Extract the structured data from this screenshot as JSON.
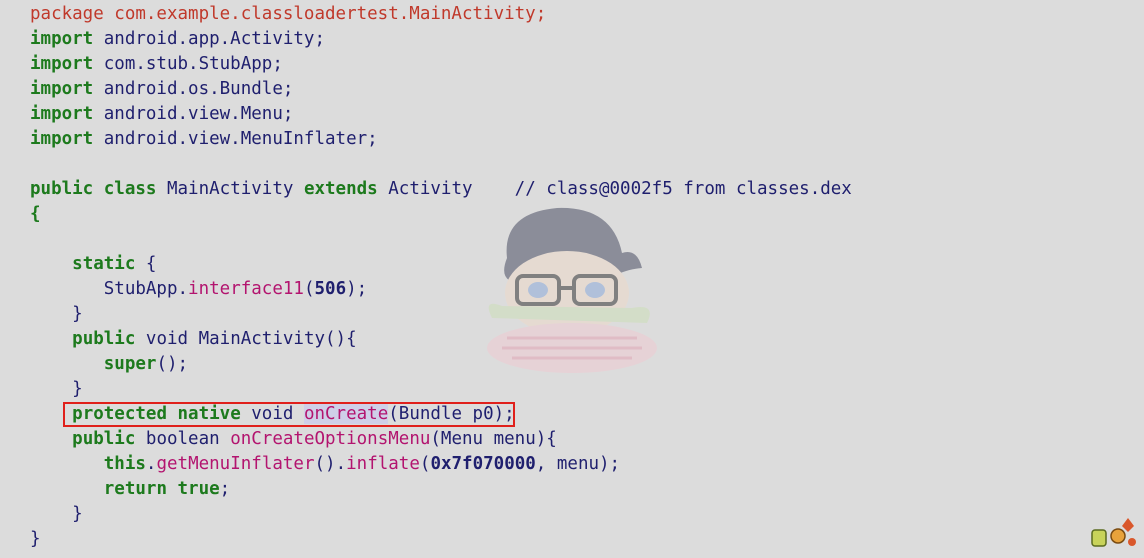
{
  "code_lines": [
    [
      {
        "t": "package com.example.classloadertest.MainActivity;",
        "c": "c-pkg"
      }
    ],
    [
      {
        "t": "import",
        "c": "c-kw"
      },
      {
        "t": " android.app.Activity;",
        "c": "c-id"
      }
    ],
    [
      {
        "t": "import",
        "c": "c-kw"
      },
      {
        "t": " com.stub.StubApp;",
        "c": "c-id"
      }
    ],
    [
      {
        "t": "import",
        "c": "c-kw"
      },
      {
        "t": " android.os.Bundle;",
        "c": "c-id"
      }
    ],
    [
      {
        "t": "import",
        "c": "c-kw"
      },
      {
        "t": " android.view.Menu;",
        "c": "c-id"
      }
    ],
    [
      {
        "t": "import",
        "c": "c-kw"
      },
      {
        "t": " android.view.MenuInflater;",
        "c": "c-id"
      }
    ],
    [],
    [
      {
        "t": "public class",
        "c": "c-kw"
      },
      {
        "t": " MainActivity ",
        "c": "c-id"
      },
      {
        "t": "extends",
        "c": "c-kw"
      },
      {
        "t": " Activity    // class@0002f5 from classes.dex",
        "c": "c-id"
      }
    ],
    [
      {
        "t": "{",
        "c": "c-kw"
      }
    ],
    [],
    [
      {
        "t": "    "
      },
      {
        "t": "static",
        "c": "c-kw"
      },
      {
        "t": " {",
        "c": "c-id"
      }
    ],
    [
      {
        "t": "       StubApp.",
        "c": "c-id"
      },
      {
        "t": "interface11",
        "c": "c-mth"
      },
      {
        "t": "(",
        "c": "c-id"
      },
      {
        "t": "506",
        "c": "c-num"
      },
      {
        "t": ");",
        "c": "c-id"
      }
    ],
    [
      {
        "t": "    }",
        "c": "c-id"
      }
    ],
    [
      {
        "t": "    "
      },
      {
        "t": "public",
        "c": "c-kw"
      },
      {
        "t": " void MainActivity(){",
        "c": "c-id"
      }
    ],
    [
      {
        "t": "       "
      },
      {
        "t": "super",
        "c": "c-kw"
      },
      {
        "t": "();",
        "c": "c-id"
      }
    ],
    [
      {
        "t": "    }",
        "c": "c-id"
      }
    ],
    [
      {
        "t": "    "
      },
      {
        "t": "protected native",
        "c": "c-kw"
      },
      {
        "t": " void ",
        "c": "c-id"
      },
      {
        "t": "onCreate",
        "c": "c-mth hl-word"
      },
      {
        "t": "(Bundle p0);",
        "c": "c-id"
      }
    ],
    [
      {
        "t": "    "
      },
      {
        "t": "public",
        "c": "c-kw"
      },
      {
        "t": " boolean ",
        "c": "c-id"
      },
      {
        "t": "onCreateOptionsMenu",
        "c": "c-mth"
      },
      {
        "t": "(Menu menu){",
        "c": "c-id"
      }
    ],
    [
      {
        "t": "       "
      },
      {
        "t": "this",
        "c": "c-kw"
      },
      {
        "t": ".",
        "c": "c-id"
      },
      {
        "t": "getMenuInflater",
        "c": "c-mth"
      },
      {
        "t": "().",
        "c": "c-id"
      },
      {
        "t": "inflate",
        "c": "c-mth"
      },
      {
        "t": "(",
        "c": "c-id"
      },
      {
        "t": "0x7f070000",
        "c": "c-num"
      },
      {
        "t": ", menu);",
        "c": "c-id"
      }
    ],
    [
      {
        "t": "       "
      },
      {
        "t": "return true",
        "c": "c-kw"
      },
      {
        "t": ";",
        "c": "c-id"
      }
    ],
    [
      {
        "t": "    }",
        "c": "c-id"
      }
    ],
    [
      {
        "t": "}",
        "c": "c-id"
      }
    ]
  ],
  "highlight": {
    "line_index": 16,
    "color": "#e0201b"
  },
  "colors": {
    "background": "#dcdcdc",
    "keyword": "#1d7a1d",
    "package": "#c0392b",
    "identifier": "#1f1f6e",
    "method": "#b3146f"
  }
}
